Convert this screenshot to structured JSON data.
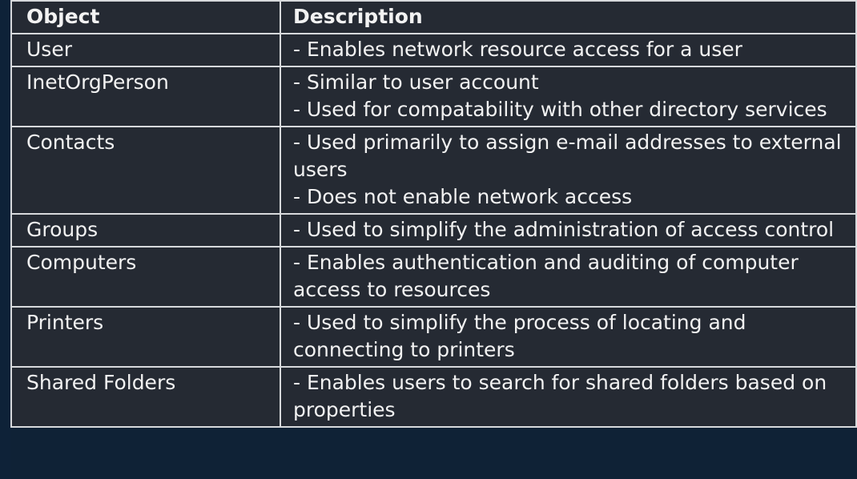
{
  "table": {
    "headers": {
      "object": "Object",
      "description": "Description"
    },
    "rows": [
      {
        "object": "User",
        "description": [
          "- Enables network resource access for a user"
        ]
      },
      {
        "object": "InetOrgPerson",
        "description": [
          "- Similar to user account",
          "- Used for compatability with other directory services"
        ]
      },
      {
        "object": "Contacts",
        "description": [
          "- Used primarily to assign e-mail addresses to external users",
          "- Does not enable network access"
        ]
      },
      {
        "object": "Groups",
        "description": [
          "- Used to simplify the administration of access control"
        ]
      },
      {
        "object": "Computers",
        "description": [
          "- Enables authentication and auditing of computer access to resources"
        ]
      },
      {
        "object": "Printers",
        "description": [
          "- Used to simplify the process of locating and connecting to printers"
        ]
      },
      {
        "object": "Shared Folders",
        "description": [
          "- Enables users to search for shared folders based on properties"
        ]
      }
    ]
  }
}
